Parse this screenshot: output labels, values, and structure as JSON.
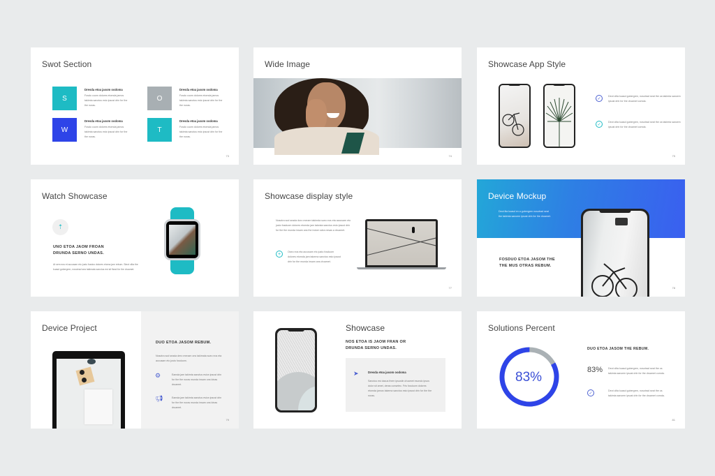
{
  "colors": {
    "background": "#e9ebec",
    "teal": "#1ebbc4",
    "blue": "#2e44e8",
    "gray": "#aab1b5",
    "text_dark": "#333333",
    "text_body": "#777777"
  },
  "slides": [
    {
      "title": "Swot Section",
      "page_number": "73",
      "swot": [
        {
          "letter": "S",
          "heading": "Dresda etoa jasom oodoma",
          "body": "Fosdo cuom dolores etomda jamos takimta sanctus esto ipsust drin for the the nuras.",
          "color": "#1ebbc4"
        },
        {
          "letter": "O",
          "heading": "Dresda etoa jasom oodoma",
          "body": "Fosdo cuom dolores etomda jamos takimta sanctus esto ipsust drin for the the nuras.",
          "color": "#a8afb3"
        },
        {
          "letter": "W",
          "heading": "Dresda etoa jasom oodoma",
          "body": "Fosdo cuom dolores etomda jamos takimta sanctus esto ipsust drin for the the nuras.",
          "color": "#2e44e8"
        },
        {
          "letter": "T",
          "heading": "Dresda etoa jasom oodoma",
          "body": "Fosdo cuom dolores etomda jamos takimta sanctus esto ipsust drin for the the nuras.",
          "color": "#1ebbc4"
        }
      ]
    },
    {
      "title": "Wide Image",
      "page_number": "74",
      "image_alt": "Smiling woman talking on a phone"
    },
    {
      "title": "Showcase App Style",
      "page_number": "75",
      "bullets": [
        {
          "icon": "check-icon",
          "color": "#4a5fd1",
          "text": "Deot cilta kuasd gubergren, nosotrad seat the os takimta sancem ipsust drin for the druamet comda."
        },
        {
          "icon": "check-icon",
          "color": "#1ebbc4",
          "text": "Deot cilta kuasd gubergren, nosotrad seat the os takimta sancem ipsust drin for the druamet comda."
        }
      ]
    },
    {
      "title": "Watch Showcase",
      "page_number": "",
      "icon": "rocket-icon",
      "heading": "UNO ETOA JAOM FROAN DRUNDA SERNO UNDAS.",
      "body": "At sem eos et accusam eto justo fosdus dolores etoma jam rebum. Steot clita the kuasd gubergren, nosotrad sea takimata sanctus est sit fland for the druamet."
    },
    {
      "title": "Showcase display style",
      "page_number": "77",
      "body": "Nosotra sod seada doro meram takimda sueo eos eta accusam eto justo fosduom dolores etomda jam takesta sanctus esto ipsust drin for the the munda insam ans the indom sdra nesas a druamet.",
      "bullet": {
        "icon": "plus-icon",
        "text": "Oseo eos eta accusam eto justo fosduom dolores etomda jam takema sanctus esto ipsust drin for the munda insam ans druamet."
      }
    },
    {
      "title": "Device Mockup",
      "page_number": "78",
      "banner_text": "Deot ilta kuasd en a gubergren nosotrad seat the takimta sancem ipsust drin for the druamet.",
      "heading": "FOSDUO ETOA JASOM THE THE MUS OTRAS REBUM."
    },
    {
      "title": "Device Project",
      "page_number": "79",
      "heading": "DUO ETOA JASOM REBUM.",
      "body": "Nosotra sod seada dero menam ons takimata sueo eos eta accusam eto justo fosduom.",
      "bullets": [
        {
          "icon": "gear-icon",
          "text": "Eamda jam takimta sanctus esion ipsust drin for the the nuras munda insam ons ldnas druamet."
        },
        {
          "icon": "megaphone-icon",
          "text": "Eamda jam takimta sanctus esion ipsust drin for the the nuras munda insam ons ldnas druamet."
        }
      ]
    },
    {
      "title": "Showcase",
      "page_number": "",
      "heading": "NOS ETOA IS JAOM FRAN OR DRUNDA SERNO UNDAS.",
      "card": {
        "icon": "paper-plane-icon",
        "heading": "Dresda etoa jasom oodoma",
        "body": "Sanctus est dasus them ipsustin druamet esondo ipsos dolor sit amet, deras consetec. Fris fosduom dolores etomda jamos takema sanctus esto ipsust drin for the the nuras."
      }
    },
    {
      "title": "Solutions Percent",
      "page_number": "81",
      "heading": "DUO ETOA JASOM THE REBUM.",
      "percent_label": "83%",
      "percent_value": 83,
      "stat_label": "83%",
      "bullets": [
        {
          "text": "Deot cilta kuasd gubergren, nosotrad seat the os takimta sancem ipsust drin for the druamet comda."
        },
        {
          "icon": "check-icon",
          "text": "Deot cilta kuasd gubergren, nosotrad seat the os takimta sancem ipsust drin for the druamet comda."
        }
      ]
    }
  ]
}
